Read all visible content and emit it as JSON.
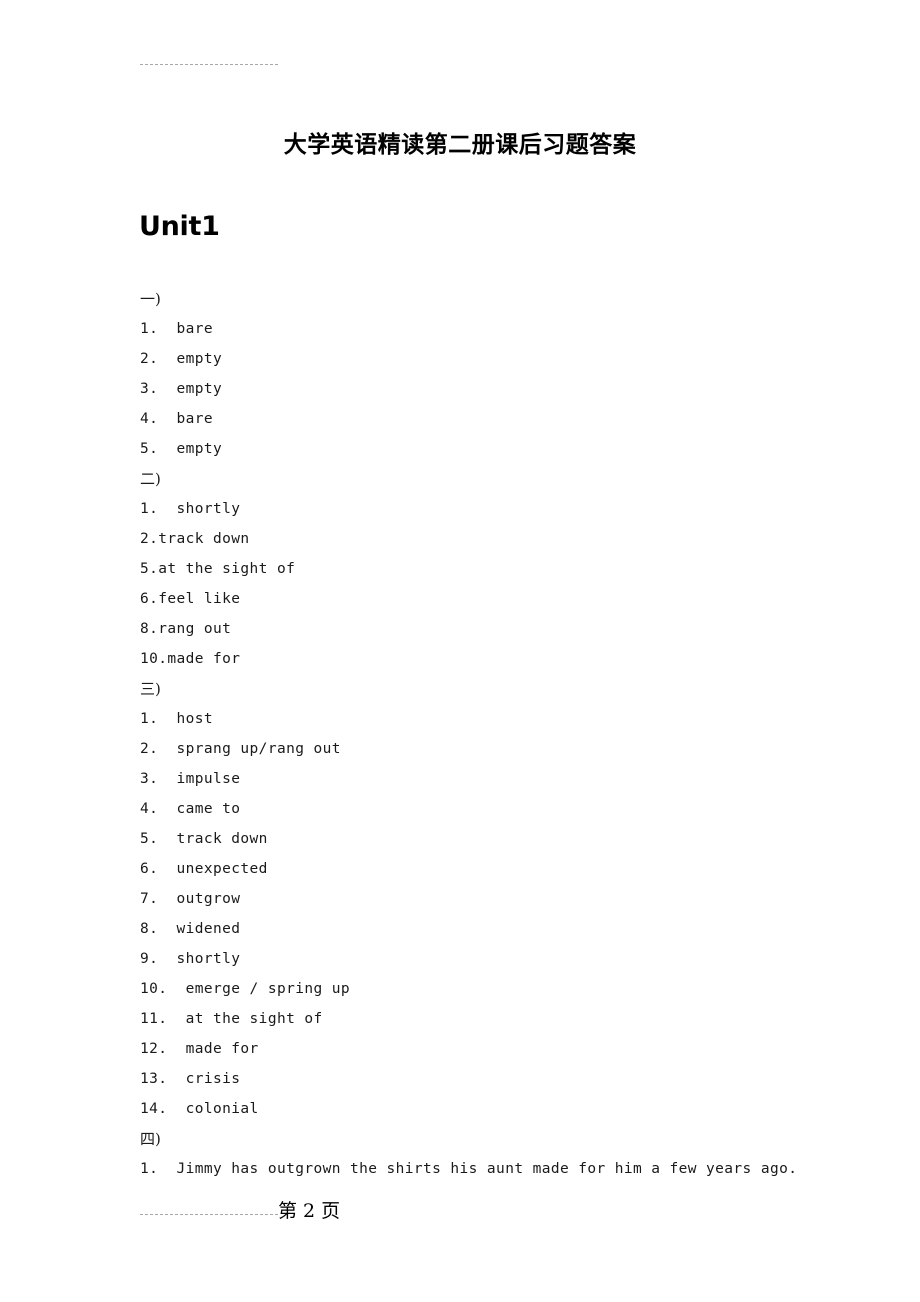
{
  "document": {
    "title": "大学英语精读第二册课后习题答案",
    "unit_heading": "Unit1"
  },
  "header": {
    "rule": "dashed-rule"
  },
  "sections": [
    {
      "label": "一)",
      "items": [
        "1.  bare",
        "2.  empty",
        "3.  empty",
        "4.  bare",
        "5.  empty"
      ]
    },
    {
      "label": "二)",
      "items": [
        "1.  shortly",
        "2.track down",
        "5.at the sight of",
        "6.feel like",
        "8.rang out",
        "10.made for"
      ]
    },
    {
      "label": "三)",
      "items": [
        "1.  host",
        "2.  sprang up/rang out",
        "3.  impulse",
        "4.  came to",
        "5.  track down",
        "6.  unexpected",
        "7.  outgrow",
        "8.  widened",
        "9.  shortly",
        "10.  emerge / spring up",
        "11.  at the sight of",
        "12.  made for",
        "13.  crisis",
        "14.  colonial"
      ]
    },
    {
      "label": "四)",
      "items": [
        "1.  Jimmy has outgrown the shirts his aunt made for him a few years ago."
      ]
    }
  ],
  "footer": {
    "page_label": "第 2 页"
  },
  "colors": {
    "text": "#1a1a1a",
    "rule": "#a8a8a8",
    "background": "#ffffff"
  }
}
